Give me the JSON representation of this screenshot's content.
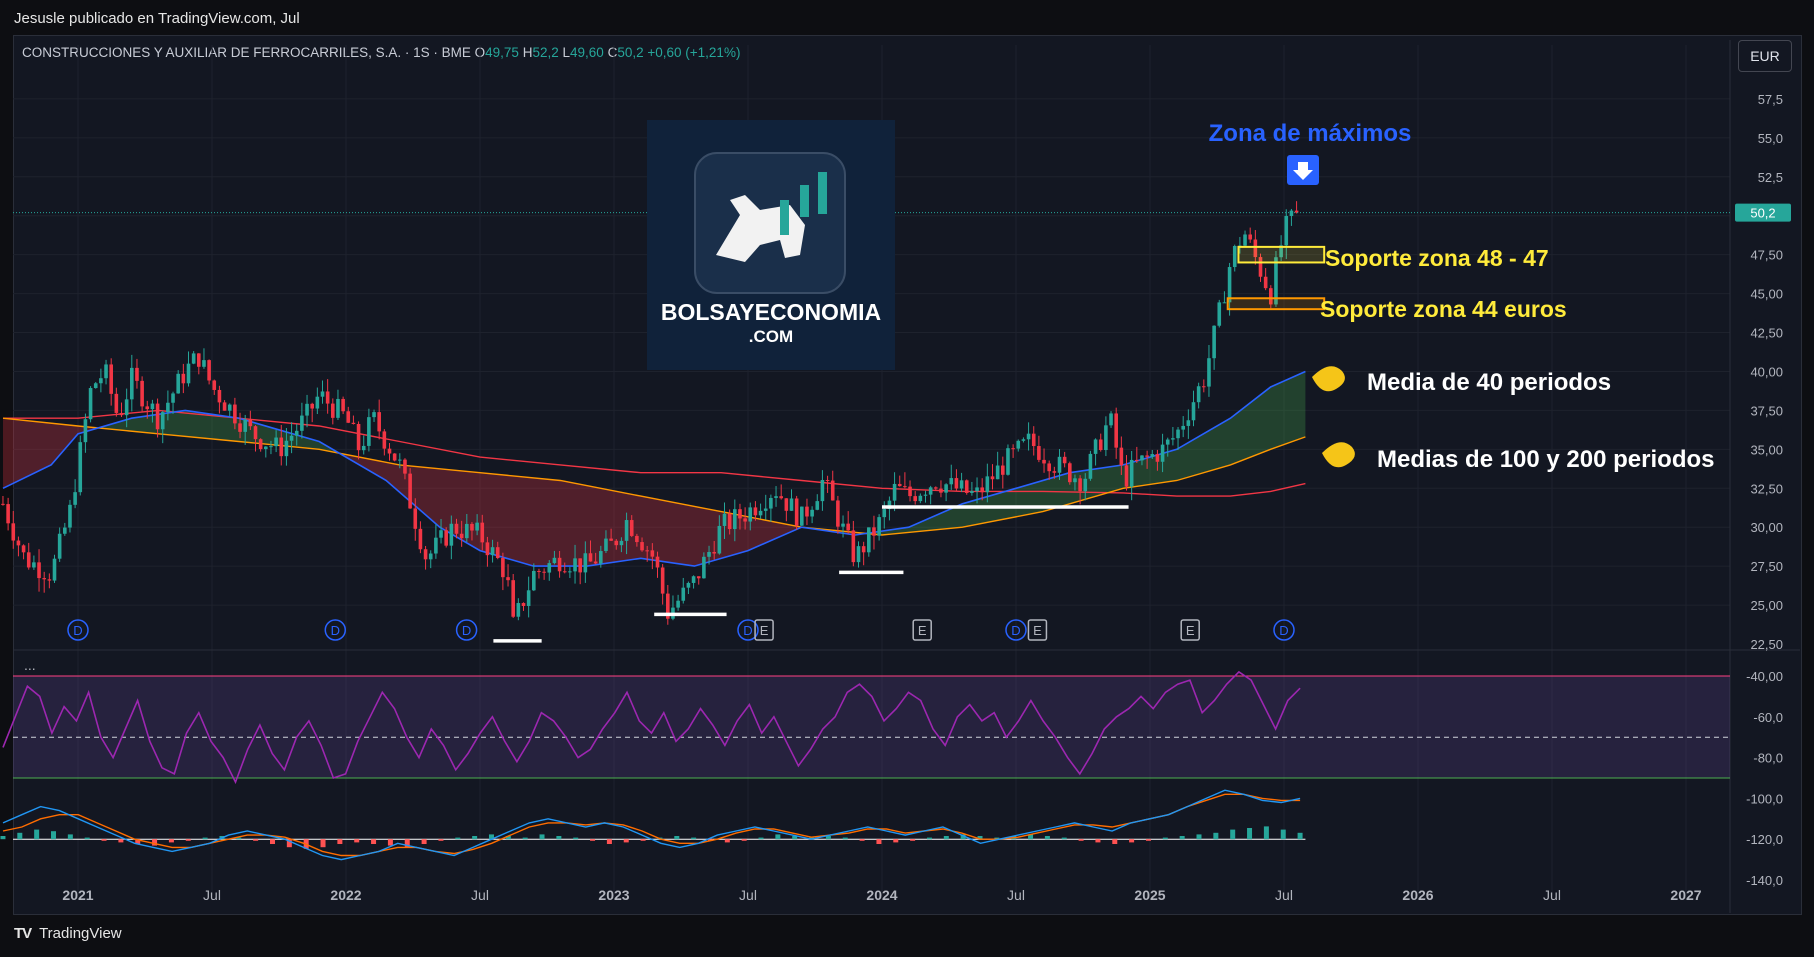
{
  "caption": "Jesusle publicado en TradingView.com, Jul",
  "symbol": {
    "name": "CONSTRUCCIONES Y AUXILIAR DE FERROCARRILES, S.A. · 1S · BME",
    "o_label": "O",
    "o": "49,75",
    "h_label": "H",
    "h": "52,2",
    "l_label": "L",
    "l": "49,60",
    "c_label": "C",
    "c": "50,2",
    "change": "+0,60 (+1,21%)"
  },
  "currency": "EUR",
  "footer": "TradingView",
  "logo": {
    "line1": "BOLSAYECONOMIA",
    "line2": ".COM"
  },
  "pane_menu": "...",
  "colors": {
    "bull": "#26a69a",
    "bear": "#f23645",
    "ma40": "#2962ff",
    "ma100": "#ff9800",
    "ma200": "#f23645",
    "rsi": "#9c27b0",
    "annotation": "#ffeb3b",
    "title_blue": "#2962ff"
  },
  "chart_data": {
    "type": "candlestick",
    "timeframe": "1S",
    "last_price": "50,2",
    "price_axis": [
      "57,5",
      "55,0",
      "52,5",
      "50,0",
      "47,50",
      "45,00",
      "42,50",
      "40,00",
      "37,50",
      "35,00",
      "32,50",
      "30,00",
      "27,50",
      "25,00",
      "22,50"
    ],
    "ylim": [
      22.5,
      60
    ],
    "x_ticks": [
      "2021",
      "Jul",
      "2022",
      "Jul",
      "2023",
      "Jul",
      "2024",
      "Jul",
      "2025",
      "Jul",
      "2026",
      "Jul",
      "2027"
    ],
    "close_path": [
      [
        2020.72,
        31.5
      ],
      [
        2020.8,
        28
      ],
      [
        2020.9,
        27
      ],
      [
        2020.97,
        31
      ],
      [
        2021.05,
        39
      ],
      [
        2021.1,
        40
      ],
      [
        2021.15,
        37
      ],
      [
        2021.2,
        39.5
      ],
      [
        2021.3,
        37
      ],
      [
        2021.4,
        40
      ],
      [
        2021.45,
        41
      ],
      [
        2021.5,
        39
      ],
      [
        2021.55,
        38
      ],
      [
        2021.65,
        36
      ],
      [
        2021.75,
        35
      ],
      [
        2021.85,
        37
      ],
      [
        2021.9,
        38.5
      ],
      [
        2022.0,
        37
      ],
      [
        2022.05,
        35
      ],
      [
        2022.1,
        37
      ],
      [
        2022.2,
        34
      ],
      [
        2022.3,
        28
      ],
      [
        2022.4,
        30
      ],
      [
        2022.5,
        29.5
      ],
      [
        2022.6,
        27
      ],
      [
        2022.62,
        23.5
      ],
      [
        2022.7,
        27
      ],
      [
        2022.8,
        28
      ],
      [
        2022.9,
        27.5
      ],
      [
        2023.0,
        29
      ],
      [
        2023.05,
        30.5
      ],
      [
        2023.15,
        28
      ],
      [
        2023.2,
        24.5
      ],
      [
        2023.3,
        26.5
      ],
      [
        2023.4,
        30
      ],
      [
        2023.5,
        31
      ],
      [
        2023.6,
        32.5
      ],
      [
        2023.7,
        30.5
      ],
      [
        2023.78,
        33
      ],
      [
        2023.85,
        30
      ],
      [
        2023.9,
        28
      ],
      [
        2024.0,
        30.5
      ],
      [
        2024.05,
        32.5
      ],
      [
        2024.1,
        32
      ],
      [
        2024.2,
        33
      ],
      [
        2024.35,
        32
      ],
      [
        2024.45,
        34
      ],
      [
        2024.55,
        35.5
      ],
      [
        2024.65,
        34
      ],
      [
        2024.75,
        33
      ],
      [
        2024.85,
        37
      ],
      [
        2024.9,
        33
      ],
      [
        2024.95,
        34
      ],
      [
        2025.05,
        35
      ],
      [
        2025.1,
        36
      ],
      [
        2025.2,
        39.5
      ],
      [
        2025.25,
        43
      ],
      [
        2025.3,
        47
      ],
      [
        2025.35,
        49
      ],
      [
        2025.4,
        47
      ],
      [
        2025.45,
        45
      ],
      [
        2025.5,
        49
      ],
      [
        2025.55,
        50.2
      ]
    ],
    "ma40": [
      [
        2020.72,
        32.5
      ],
      [
        2020.9,
        34
      ],
      [
        2021.0,
        36
      ],
      [
        2021.2,
        37
      ],
      [
        2021.4,
        37.5
      ],
      [
        2021.6,
        37
      ],
      [
        2021.9,
        35.5
      ],
      [
        2022.15,
        33
      ],
      [
        2022.35,
        30
      ],
      [
        2022.5,
        28.5
      ],
      [
        2022.7,
        27.5
      ],
      [
        2022.9,
        27.5
      ],
      [
        2023.1,
        28
      ],
      [
        2023.3,
        27.5
      ],
      [
        2023.5,
        28.5
      ],
      [
        2023.7,
        30
      ],
      [
        2023.9,
        29.5
      ],
      [
        2024.1,
        30
      ],
      [
        2024.3,
        31.5
      ],
      [
        2024.5,
        32.5
      ],
      [
        2024.7,
        33.5
      ],
      [
        2024.9,
        34
      ],
      [
        2025.1,
        35
      ],
      [
        2025.3,
        37
      ],
      [
        2025.45,
        39
      ],
      [
        2025.58,
        40
      ]
    ],
    "ma100": [
      [
        2020.72,
        37
      ],
      [
        2021.0,
        36.5
      ],
      [
        2021.3,
        36
      ],
      [
        2021.6,
        35.5
      ],
      [
        2021.9,
        35
      ],
      [
        2022.2,
        34
      ],
      [
        2022.5,
        33.5
      ],
      [
        2022.8,
        33
      ],
      [
        2023.1,
        32
      ],
      [
        2023.4,
        31
      ],
      [
        2023.7,
        30
      ],
      [
        2024.0,
        29.5
      ],
      [
        2024.3,
        30
      ],
      [
        2024.6,
        31
      ],
      [
        2024.9,
        32.5
      ],
      [
        2025.1,
        33
      ],
      [
        2025.3,
        34
      ],
      [
        2025.45,
        35
      ],
      [
        2025.58,
        35.8
      ]
    ],
    "ma200": [
      [
        2020.72,
        37
      ],
      [
        2021.0,
        37
      ],
      [
        2021.3,
        37.5
      ],
      [
        2021.6,
        37
      ],
      [
        2021.9,
        36.5
      ],
      [
        2022.2,
        35.5
      ],
      [
        2022.5,
        34.5
      ],
      [
        2022.8,
        34
      ],
      [
        2023.1,
        33.5
      ],
      [
        2023.4,
        33.5
      ],
      [
        2023.7,
        33
      ],
      [
        2024.0,
        32.5
      ],
      [
        2024.3,
        32.3
      ],
      [
        2024.6,
        32.3
      ],
      [
        2024.9,
        32.2
      ],
      [
        2025.1,
        32
      ],
      [
        2025.3,
        32
      ],
      [
        2025.45,
        32.3
      ],
      [
        2025.58,
        32.8
      ]
    ],
    "support_lines": [
      {
        "x0": 2022.55,
        "x1": 2022.73,
        "y": 22.7
      },
      {
        "x0": 2023.15,
        "x1": 2023.42,
        "y": 24.4
      },
      {
        "x0": 2023.84,
        "x1": 2024.08,
        "y": 27.1
      },
      {
        "x0": 2024.0,
        "x1": 2024.92,
        "y": 31.3
      }
    ],
    "zones": [
      {
        "y0": 47,
        "y1": 48
      },
      {
        "y0": 44,
        "y1": 44.7
      }
    ],
    "event_markers": [
      {
        "x": 2021.0,
        "label": "D"
      },
      {
        "x": 2021.96,
        "label": "D"
      },
      {
        "x": 2022.45,
        "label": "D"
      },
      {
        "x": 2023.5,
        "label": "D"
      },
      {
        "x": 2023.56,
        "label": "E"
      },
      {
        "x": 2024.15,
        "label": "E"
      },
      {
        "x": 2024.5,
        "label": "D"
      },
      {
        "x": 2024.58,
        "label": "E"
      },
      {
        "x": 2025.15,
        "label": "E"
      },
      {
        "x": 2025.5,
        "label": "D"
      }
    ],
    "annotations": {
      "top": "Zona de máximos",
      "zone1": "Soporte zona 48 - 47",
      "zone2": "Soporte zona 44 euros",
      "ma40": "Media de 40 periodos",
      "ma100_200": "Medias de 100 y 200 periodos"
    },
    "osc_axis": [
      "-40,00",
      "-60,0",
      "-80,0",
      "-100,0",
      "-120,0",
      "-140,0"
    ],
    "rsi": {
      "upper": -40,
      "lower": -90,
      "mid": -70,
      "values": [
        -75,
        -60,
        -45,
        -50,
        -68,
        -55,
        -62,
        -48,
        -70,
        -80,
        -66,
        -52,
        -72,
        -85,
        -88,
        -68,
        -58,
        -72,
        -80,
        -92,
        -76,
        -64,
        -78,
        -86,
        -70,
        -62,
        -74,
        -90,
        -88,
        -72,
        -60,
        -48,
        -56,
        -70,
        -80,
        -66,
        -74,
        -86,
        -78,
        -68,
        -60,
        -72,
        -82,
        -72,
        -58,
        -62,
        -70,
        -80,
        -76,
        -66,
        -58,
        -48,
        -62,
        -68,
        -58,
        -72,
        -66,
        -56,
        -64,
        -74,
        -62,
        -54,
        -68,
        -60,
        -72,
        -84,
        -76,
        -66,
        -60,
        -48,
        -44,
        -50,
        -62,
        -56,
        -48,
        -52,
        -66,
        -74,
        -60,
        -54,
        -62,
        -58,
        -70,
        -62,
        -52,
        -62,
        -70,
        -80,
        -88,
        -78,
        -66,
        -60,
        -56,
        -50,
        -56,
        -48,
        -44,
        -42,
        -58,
        -52,
        -44,
        -38,
        -42,
        -54,
        -66,
        -52,
        -46
      ]
    },
    "macd": {
      "hist": [
        2,
        4,
        6,
        5,
        3,
        1,
        -1,
        -2,
        -3,
        -4,
        -2,
        -1,
        1,
        2,
        1,
        -1,
        -3,
        -5,
        -6,
        -5,
        -3,
        -2,
        -3,
        -4,
        -5,
        -3,
        -1,
        1,
        2,
        3,
        2,
        1,
        3,
        2,
        1,
        -1,
        -3,
        -2,
        -1,
        1,
        2,
        1,
        -1,
        -2,
        -1,
        1,
        3,
        2,
        1,
        2,
        1,
        -1,
        -3,
        -2,
        -1,
        1,
        2,
        3,
        2,
        1,
        2,
        3,
        2,
        1,
        -1,
        -2,
        -3,
        -2,
        -1,
        1,
        2,
        3,
        4,
        6,
        7,
        8,
        6,
        4
      ],
      "macd_line": [
        -112,
        -108,
        -104,
        -106,
        -110,
        -114,
        -118,
        -122,
        -124,
        -126,
        -124,
        -122,
        -118,
        -116,
        -118,
        -120,
        -124,
        -128,
        -130,
        -128,
        -126,
        -122,
        -124,
        -126,
        -128,
        -124,
        -120,
        -116,
        -112,
        -110,
        -112,
        -114,
        -112,
        -114,
        -118,
        -122,
        -124,
        -122,
        -118,
        -116,
        -114,
        -116,
        -118,
        -120,
        -118,
        -116,
        -114,
        -116,
        -118,
        -116,
        -114,
        -118,
        -122,
        -120,
        -118,
        -116,
        -114,
        -112,
        -114,
        -116,
        -112,
        -110,
        -108,
        -104,
        -100,
        -96,
        -98,
        -101,
        -102,
        -100
      ],
      "signal_line": [
        -116,
        -114,
        -110,
        -108,
        -108,
        -112,
        -116,
        -120,
        -122,
        -124,
        -124,
        -122,
        -120,
        -118,
        -118,
        -119,
        -122,
        -126,
        -128,
        -128,
        -126,
        -124,
        -124,
        -126,
        -127,
        -125,
        -122,
        -118,
        -114,
        -112,
        -112,
        -113,
        -112,
        -113,
        -116,
        -120,
        -122,
        -122,
        -120,
        -117,
        -115,
        -115,
        -117,
        -119,
        -118,
        -117,
        -115,
        -115,
        -117,
        -116,
        -115,
        -117,
        -120,
        -120,
        -119,
        -117,
        -115,
        -113,
        -113,
        -114,
        -112,
        -110,
        -108,
        -104,
        -101,
        -98,
        -98,
        -100,
        -101,
        -101
      ]
    }
  }
}
